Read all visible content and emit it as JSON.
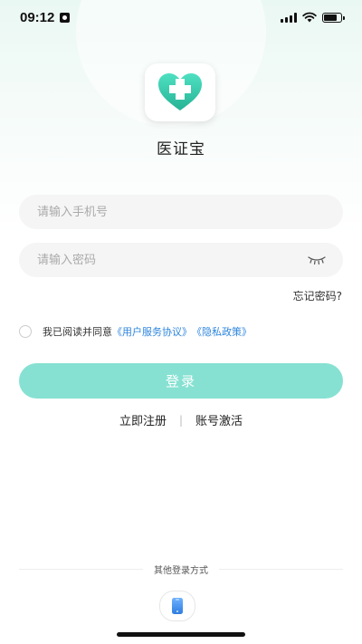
{
  "status_bar": {
    "time": "09:12",
    "icons": [
      "person-badge-icon",
      "cellular-signal-icon",
      "wifi-icon",
      "battery-icon"
    ],
    "battery_level": 0.8
  },
  "app": {
    "name": "医证宝",
    "logo_icon": "heart-cross-icon",
    "logo_colors": [
      "#3dd6b8",
      "#2bb59a"
    ]
  },
  "form": {
    "phone_placeholder": "请输入手机号",
    "password_placeholder": "请输入密码",
    "password_toggle_icon": "eye-closed-icon",
    "forgot_password": "忘记密码?"
  },
  "agreement": {
    "prefix": "我已阅读并同意",
    "user_agreement": "《用户服务协议》",
    "privacy_policy": "《隐私政策》",
    "checked": false
  },
  "login_button": "登录",
  "links": {
    "register": "立即注册",
    "separator": "|",
    "activate": "账号激活"
  },
  "other_login": {
    "label": "其他登录方式",
    "phone_icon": "mobile-phone-icon"
  },
  "colors": {
    "accent": "#86e1d2",
    "link": "#2e86de",
    "input_bg": "#f5f5f5"
  }
}
